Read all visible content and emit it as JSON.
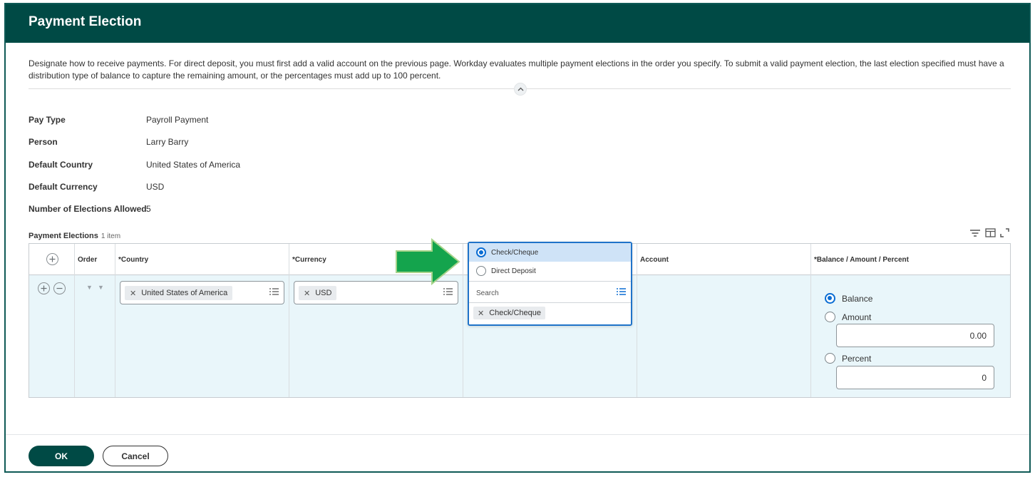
{
  "header": {
    "title": "Payment Election"
  },
  "description": "Designate how to receive payments. For direct deposit, you must first add a valid account on the previous page. Workday evaluates multiple payment elections in the order you specify. To submit a valid payment election, the last election specified must have a distribution type of balance to capture the remaining amount, or the percentages must add up to 100 percent.",
  "fields": [
    {
      "label": "Pay Type",
      "value": "Payroll Payment"
    },
    {
      "label": "Person",
      "value": "Larry Barry"
    },
    {
      "label": "Default Country",
      "value": "United States of America"
    },
    {
      "label": "Default Currency",
      "value": "USD"
    },
    {
      "label": "Number of Elections Allowed",
      "value": "5"
    }
  ],
  "grid": {
    "title": "Payment Elections",
    "count": "1 item",
    "columns": {
      "order": "Order",
      "country": "*Country",
      "currency": "*Currency",
      "account": "Account",
      "balance": "*Balance / Amount / Percent"
    },
    "row": {
      "country": "United States of America",
      "currency": "USD",
      "payment_type": "Check/Cheque",
      "distribution": "Balance",
      "amount_value": "0.00",
      "percent_value": "0"
    },
    "distribution_options": [
      "Balance",
      "Amount",
      "Percent"
    ]
  },
  "dropdown": {
    "options": [
      "Check/Cheque",
      "Direct Deposit"
    ],
    "selected": "Check/Cheque",
    "search_placeholder": "Search",
    "selected_pill": "Check/Cheque"
  },
  "buttons": {
    "ok": "OK",
    "cancel": "Cancel"
  },
  "colors": {
    "brand": "#004a45",
    "selection": "#0b6dd3",
    "arrow": "#1aa34a",
    "row_bg": "#e9f6fa"
  }
}
